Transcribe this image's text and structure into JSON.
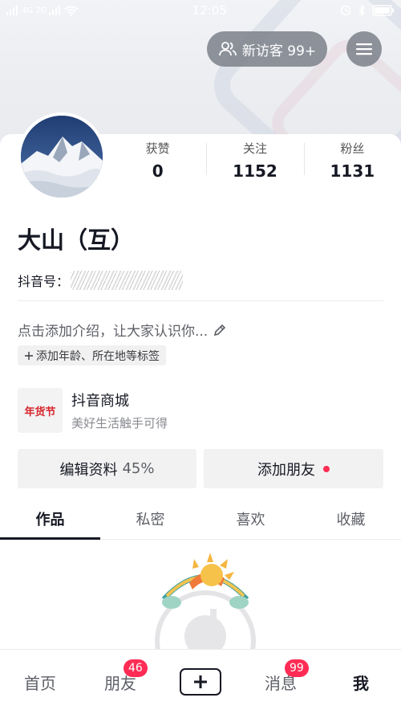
{
  "status_bar": {
    "time": "12:05",
    "signal_text": "4G 2G"
  },
  "header": {
    "visitors_label": "新访客 99+"
  },
  "profile": {
    "name": "大山（互）",
    "douyin_id_label": "抖音号：",
    "stats": [
      {
        "label": "获赞",
        "value": "0"
      },
      {
        "label": "关注",
        "value": "1152"
      },
      {
        "label": "粉丝",
        "value": "1131"
      }
    ],
    "bio_placeholder": "点击添加介绍，让大家认识你...",
    "add_tags_label": "添加年龄、所在地等标签"
  },
  "shop": {
    "logo_text": "年货节",
    "title": "抖音商城",
    "subtitle": "美好生活触手可得"
  },
  "actions": {
    "edit_label": "编辑资料",
    "edit_percent": "45%",
    "add_friend_label": "添加朋友"
  },
  "tabs": [
    {
      "label": "作品",
      "active": true
    },
    {
      "label": "私密"
    },
    {
      "label": "喜欢"
    },
    {
      "label": "收藏"
    }
  ],
  "bottom_nav": {
    "home": "首页",
    "friends": "朋友",
    "friends_badge": "46",
    "messages": "消息",
    "messages_badge": "99",
    "me": "我"
  },
  "colors": {
    "accent": "#fe2c55",
    "text": "#161823",
    "muted": "#5d5f66"
  }
}
